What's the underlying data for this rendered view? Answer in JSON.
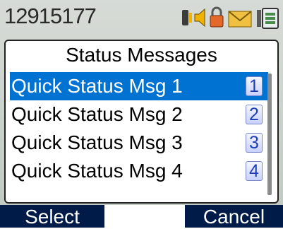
{
  "status_bar": {
    "radio_id": "12915177",
    "icons": [
      "lone-worker-icon",
      "speaker-icon",
      "lock-icon",
      "envelope-icon",
      "battery-icon"
    ]
  },
  "dialog": {
    "title": "Status Messages",
    "items": [
      {
        "label": "Quick Status Msg 1",
        "key": "1"
      },
      {
        "label": "Quick Status Msg 2",
        "key": "2"
      },
      {
        "label": "Quick Status Msg 3",
        "key": "3"
      },
      {
        "label": "Quick Status Msg 4",
        "key": "4"
      }
    ],
    "selected_index": 0
  },
  "softkeys": {
    "left": "Select",
    "middle": "",
    "right": "Cancel"
  },
  "colors": {
    "selection": "#0073d2",
    "softkey_bg": "#001b47",
    "key_badge_text": "#1f3db5"
  }
}
